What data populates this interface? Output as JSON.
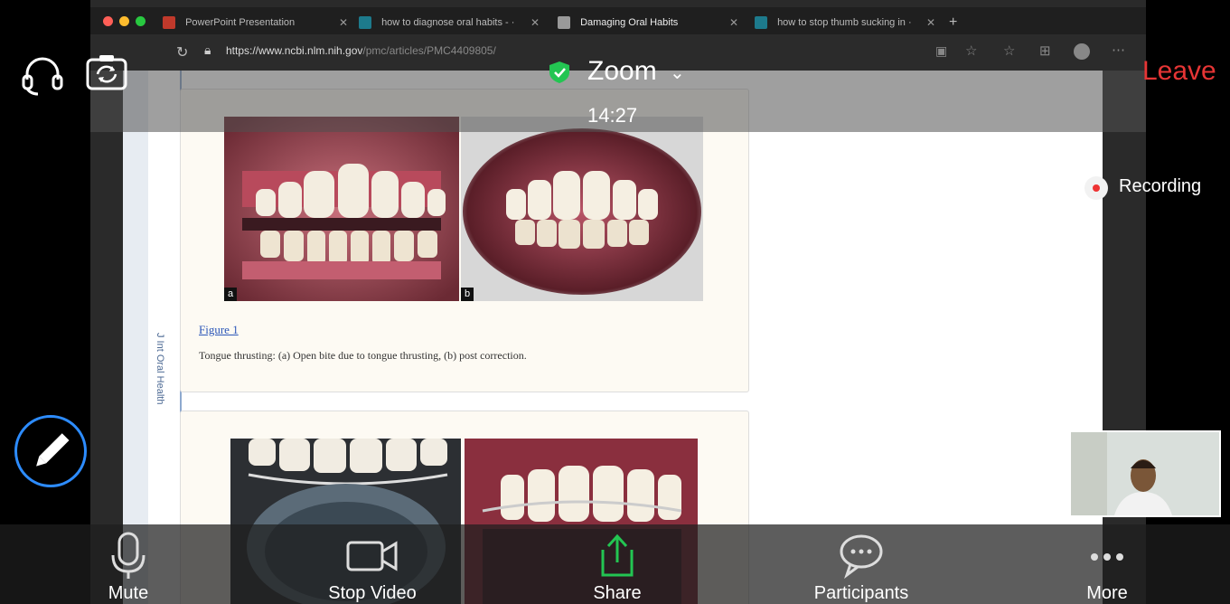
{
  "browser": {
    "tabs": [
      {
        "label": "PowerPoint Presentation",
        "icon": "powerpoint-icon",
        "icon_color": "#c0392b"
      },
      {
        "label": "how to diagnose oral habits - ·",
        "icon": "bing-icon",
        "icon_color": "#1d7a8c"
      },
      {
        "label": "Damaging Oral Habits",
        "icon": "document-icon",
        "icon_color": "#999999"
      },
      {
        "label": "how to stop thumb sucking in ·",
        "icon": "bing-icon",
        "icon_color": "#1d7a8c"
      }
    ],
    "new_tab": "+",
    "url_host": "https://www.ncbi.nlm.nih.gov",
    "url_path": "/pmc/articles/PMC4409805/"
  },
  "article": {
    "journal": "J Int Oral Health",
    "figure1": {
      "label_a": "a",
      "label_b": "b",
      "link": "Figure 1",
      "caption": "Tongue thrusting: (a) Open bite due to tongue thrusting, (b) post correction."
    }
  },
  "zoom": {
    "title": "Zoom",
    "time": "14:27",
    "leave": "Leave",
    "recording": "Recording",
    "toolbar": {
      "mute": "Mute",
      "stop_video": "Stop Video",
      "share": "Share",
      "participants": "Participants",
      "more": "More"
    },
    "colors": {
      "leave": "#e63535",
      "share": "#23c552",
      "accent": "#2d8cff",
      "shield": "#23c552"
    }
  }
}
